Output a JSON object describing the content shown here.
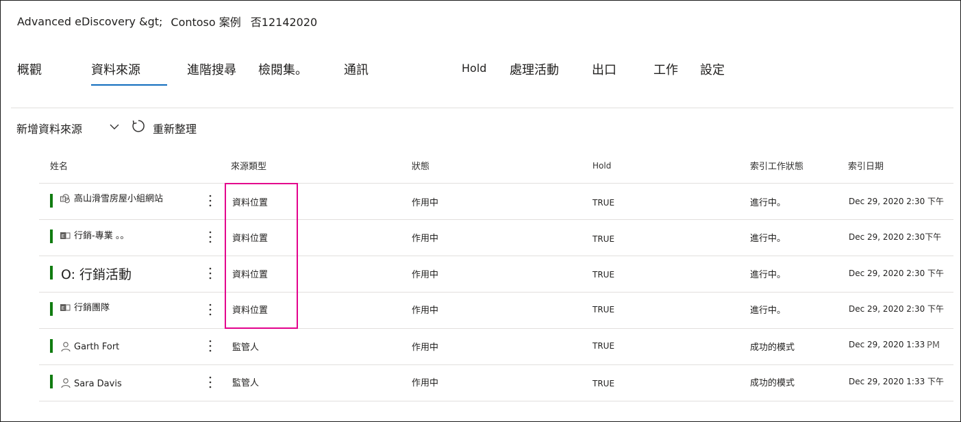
{
  "breadcrumb": {
    "root": "Advanced eDiscovery &gt;",
    "case": "Contoso 案例",
    "id": "否12142020"
  },
  "tabs": [
    {
      "label": "概觀"
    },
    {
      "label": "資料來源"
    },
    {
      "label": "進階搜尋"
    },
    {
      "label": "檢閱集。"
    },
    {
      "label": "通訊"
    },
    {
      "label": "Hold"
    },
    {
      "label": "處理活動"
    },
    {
      "label": "出口"
    },
    {
      "label": "工作"
    },
    {
      "label": "設定"
    }
  ],
  "selected_tab": "資料來源",
  "toolbar": {
    "add_label": "新增資料來源",
    "refresh_label": "重新整理"
  },
  "columns": {
    "name": "姓名",
    "source_type": "來源類型",
    "status": "狀態",
    "hold": "Hold",
    "index_status": "索引工作狀態",
    "index_date": "索引日期"
  },
  "rows": [
    {
      "icon": "sharepoint-icon",
      "name": "高山滑雪房屋小組網站",
      "source_type": "資料位置",
      "status": "作用中",
      "hold": "TRUE",
      "index_status": "進行中。",
      "index_date": "Dec 29, 2020 2:30 下午"
    },
    {
      "icon": "exchange-icon",
      "name": "行銷-專業 。。",
      "source_type": "資料位置",
      "status": "作用中",
      "hold": "TRUE",
      "index_status": "進行中。",
      "index_date": "Dec 29, 2020 2:30下午"
    },
    {
      "icon": "",
      "name": "O: 行銷活動",
      "source_type": "資料位置",
      "status": "作用中",
      "hold": "TRUE",
      "index_status": "進行中。",
      "index_date": "Dec 29, 2020 2:30 下午"
    },
    {
      "icon": "exchange-icon",
      "name": "行銷團隊",
      "source_type": "資料位置",
      "status": "作用中",
      "hold": "TRUE",
      "index_status": "進行中。",
      "index_date": "Dec 29, 2020 2:30 下午"
    },
    {
      "icon": "person-icon",
      "name": "Garth Fort",
      "source_type": "監管人",
      "status": "作用中",
      "hold": "TRUE",
      "index_status": "成功的模式",
      "index_date": "Dec 29, 2020 1:33",
      "index_date_suffix": "PM"
    },
    {
      "icon": "person-icon",
      "name": "Sara Davis",
      "source_type": "監管人",
      "status": "作用中",
      "hold": "TRUE",
      "index_status": "成功的模式",
      "index_date": "Dec 29, 2020 1:33 下午"
    }
  ],
  "colors": {
    "accent": "#0f6cbd",
    "status_active": "#107c10",
    "highlight": "#e3008c"
  }
}
